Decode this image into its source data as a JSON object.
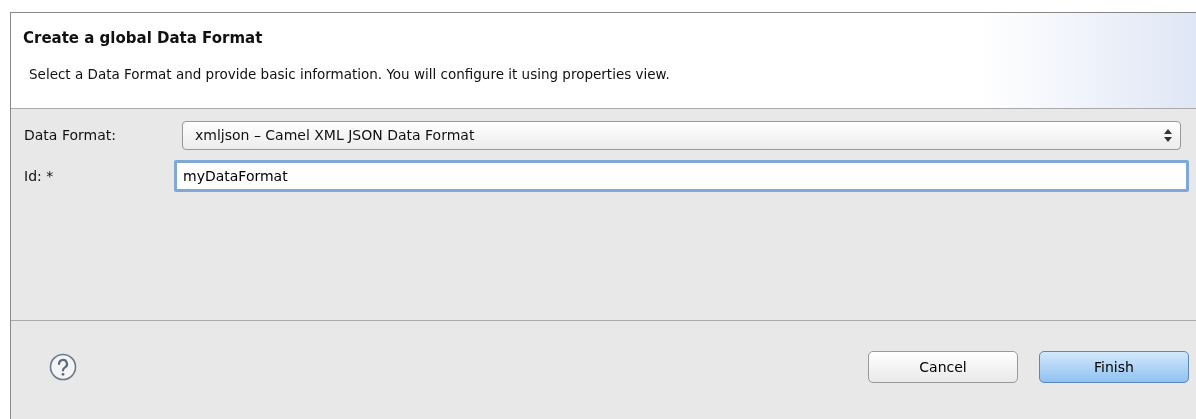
{
  "header": {
    "title": "Create a global Data Format",
    "description": "Select a Data Format and provide basic information. You will configure it using properties view."
  },
  "fields": [
    {
      "label": "Data Format:",
      "kind": "select",
      "value": "xmljson – Camel XML JSON Data Format"
    },
    {
      "label": "Id: *",
      "kind": "text",
      "value": "myDataFormat"
    }
  ],
  "buttons": [
    {
      "label": "Cancel",
      "default": false
    },
    {
      "label": "Finish",
      "default": true
    }
  ]
}
